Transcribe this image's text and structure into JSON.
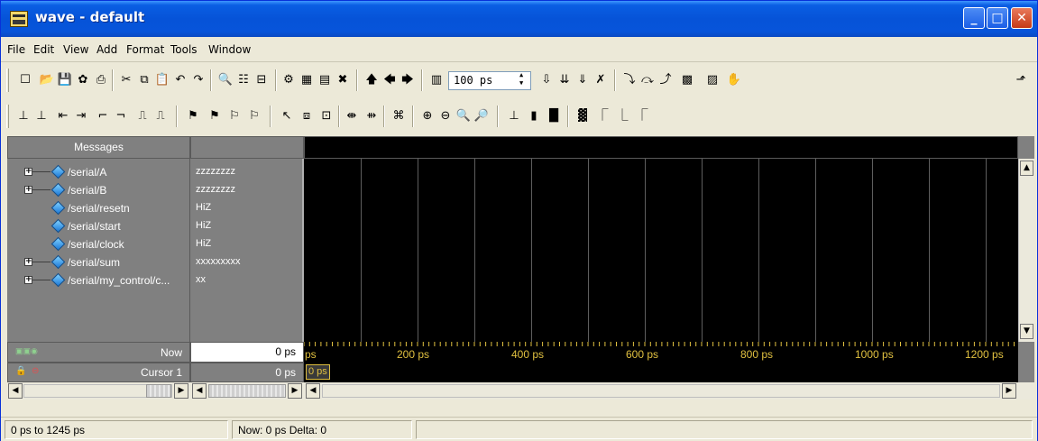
{
  "window": {
    "title": "wave - default"
  },
  "menu": [
    "File",
    "Edit",
    "View",
    "Add",
    "Format",
    "Tools",
    "Window"
  ],
  "toolbar": {
    "zoom_value": "100 ps"
  },
  "panes": {
    "messages_header": "Messages"
  },
  "signals": [
    {
      "name": "/serial/A",
      "value": "zzzzzzzz",
      "expandable": true
    },
    {
      "name": "/serial/B",
      "value": "zzzzzzzz",
      "expandable": true
    },
    {
      "name": "/serial/resetn",
      "value": "HiZ",
      "expandable": false
    },
    {
      "name": "/serial/start",
      "value": "HiZ",
      "expandable": false
    },
    {
      "name": "/serial/clock",
      "value": "HiZ",
      "expandable": false
    },
    {
      "name": "/serial/sum",
      "value": "xxxxxxxxx",
      "expandable": true
    },
    {
      "name": "/serial/my_control/c...",
      "value": "xx",
      "expandable": true
    }
  ],
  "now_row": {
    "label": "Now",
    "value": "0 ps"
  },
  "cursor_row": {
    "label": "Cursor 1",
    "value": "0 ps",
    "marker": "0 ps"
  },
  "timeline": {
    "start_label": "ps",
    "ticks": [
      "200 ps",
      "400 ps",
      "600 ps",
      "800 ps",
      "1000 ps",
      "1200 ps"
    ]
  },
  "status": {
    "range": "0 ps to 1245 ps",
    "now_delta": "Now: 0 ps  Delta: 0"
  },
  "colors": {
    "title_bar": "#0653d8",
    "wave_bg": "#000000",
    "pane_bg": "#808080",
    "timeline_text": "#e0c040"
  }
}
